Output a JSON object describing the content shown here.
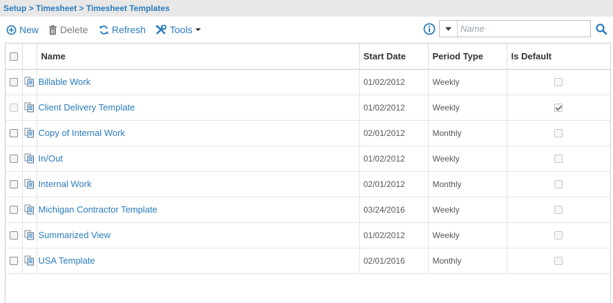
{
  "breadcrumb": {
    "items": [
      "Setup",
      "Timesheet",
      "Timesheet Templates"
    ],
    "separator": ">"
  },
  "toolbar": {
    "new_label": "New",
    "delete_label": "Delete",
    "refresh_label": "Refresh",
    "tools_label": "Tools"
  },
  "search": {
    "placeholder": "Name",
    "value": ""
  },
  "table": {
    "headers": {
      "name": "Name",
      "start_date": "Start Date",
      "period_type": "Period Type",
      "is_default": "Is Default"
    },
    "rows": [
      {
        "name": "Billable Work",
        "start_date": "01/02/2012",
        "period_type": "Weekly",
        "is_default": false,
        "select_enabled": true
      },
      {
        "name": "Client Delivery Template",
        "start_date": "01/02/2012",
        "period_type": "Weekly",
        "is_default": true,
        "select_enabled": false
      },
      {
        "name": "Copy of Internal Work",
        "start_date": "02/01/2012",
        "period_type": "Monthly",
        "is_default": false,
        "select_enabled": true
      },
      {
        "name": "In/Out",
        "start_date": "01/02/2012",
        "period_type": "Weekly",
        "is_default": false,
        "select_enabled": true
      },
      {
        "name": "Internal Work",
        "start_date": "02/01/2012",
        "period_type": "Monthly",
        "is_default": false,
        "select_enabled": true
      },
      {
        "name": "Michigan Contractor Template",
        "start_date": "03/24/2016",
        "period_type": "Weekly",
        "is_default": false,
        "select_enabled": true
      },
      {
        "name": "Summarized View",
        "start_date": "01/02/2012",
        "period_type": "Weekly",
        "is_default": false,
        "select_enabled": true
      },
      {
        "name": "USA Template",
        "start_date": "02/01/2016",
        "period_type": "Monthly",
        "is_default": false,
        "select_enabled": true
      }
    ]
  },
  "colors": {
    "accent": "#2a7bbd",
    "breadcrumb_bg": "#e8e8e8",
    "disabled_text": "#7a7a7a"
  },
  "icons": {
    "new": "plus-circle-icon",
    "delete": "trash-icon",
    "refresh": "refresh-icon",
    "tools": "tools-icon",
    "info": "info-icon",
    "search": "search-icon",
    "row": "document-icon"
  }
}
